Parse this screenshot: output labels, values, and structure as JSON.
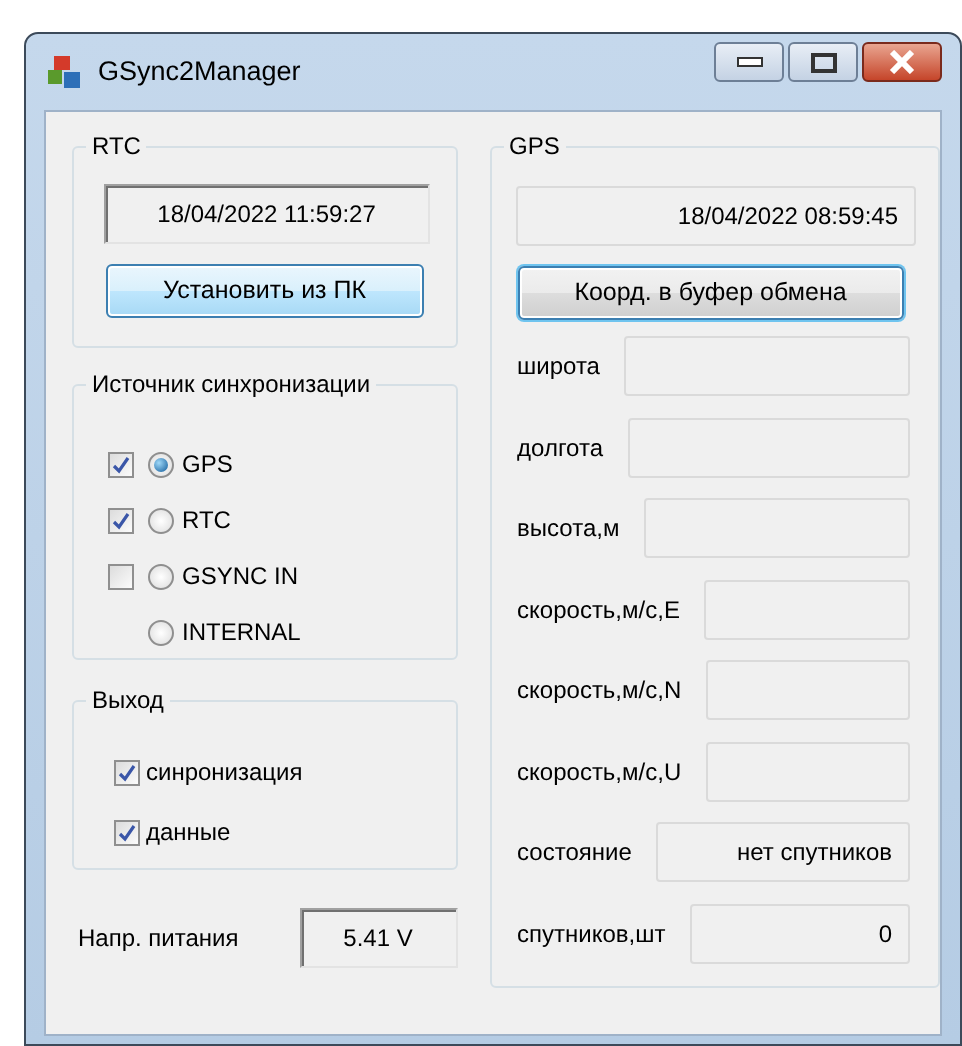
{
  "window": {
    "title": "GSync2Manager"
  },
  "rtc": {
    "title": "RTC",
    "time": "18/04/2022 11:59:27",
    "button": "Установить из ПК"
  },
  "sync_source": {
    "title": "Источник синхронизации",
    "rows": [
      {
        "label": "GPS",
        "checked": true,
        "selected": true
      },
      {
        "label": "RTC",
        "checked": true,
        "selected": false
      },
      {
        "label": "GSYNC IN",
        "checked": false,
        "selected": false
      },
      {
        "label": "INTERNAL",
        "selected": false
      }
    ]
  },
  "output": {
    "title": "Выход",
    "items": [
      {
        "label": "синронизация",
        "checked": true
      },
      {
        "label": "данные",
        "checked": true
      }
    ]
  },
  "power": {
    "label": "Напр. питания",
    "value": "5.41 V"
  },
  "gps": {
    "title": "GPS",
    "time": "18/04/2022 08:59:45",
    "button": "Коорд. в буфер обмена",
    "fields": [
      {
        "label": "широта"
      },
      {
        "label": "долгота"
      },
      {
        "label": "высота,м"
      },
      {
        "label": "скорость,м/с,E"
      },
      {
        "label": "скорость,м/с,N"
      },
      {
        "label": "скорость,м/с,U"
      },
      {
        "label": "состояние",
        "value": "нет спутников"
      },
      {
        "label": "спутников,шт",
        "value": "0"
      }
    ]
  }
}
